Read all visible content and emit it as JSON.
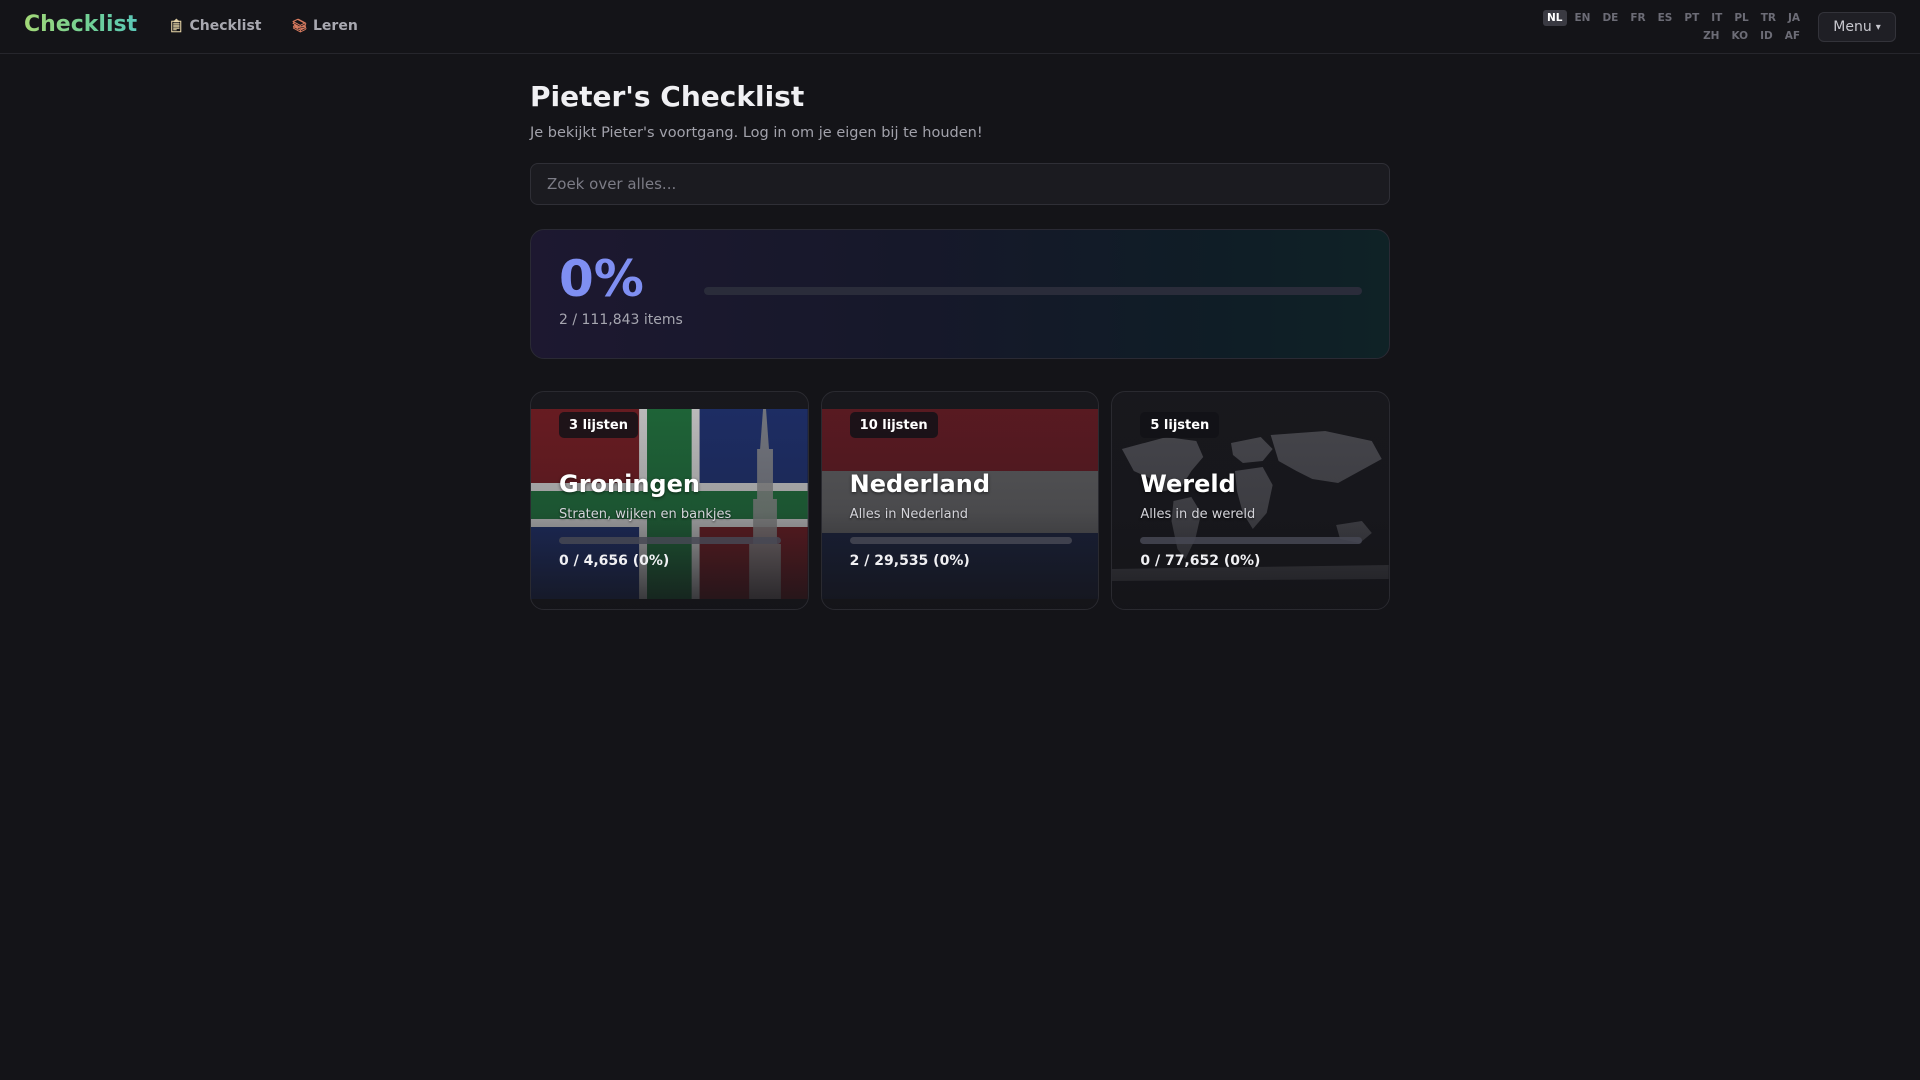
{
  "header": {
    "brand": "Checklist",
    "nav": [
      {
        "label": "Checklist",
        "icon": "clipboard-icon"
      },
      {
        "label": "Leren",
        "icon": "books-icon"
      }
    ],
    "languages": [
      "NL",
      "EN",
      "DE",
      "FR",
      "ES",
      "PT",
      "IT",
      "PL",
      "TR",
      "JA",
      "ZH",
      "KO",
      "ID",
      "AF"
    ],
    "active_language": "NL",
    "menu_label": "Menu",
    "menu_icon": "caret-down-icon"
  },
  "page": {
    "title": "Pieter's Checklist",
    "subtitle": "Je bekijkt Pieter's voortgang. Log in om je eigen bij te houden!",
    "search_placeholder": "Zoek over alles..."
  },
  "overall": {
    "percent_label": "0%",
    "count_label": "2 / 111,843 items",
    "completed": 2,
    "total": 111843,
    "accent_color": "#7f8ff2"
  },
  "categories": [
    {
      "badge": "3 lijsten",
      "title": "Groningen",
      "subtitle": "Straten, wijken en bankjes",
      "count_label": "0 / 4,656 (0%)",
      "done": 0,
      "total": 4656,
      "image": "groningen-flag-tower"
    },
    {
      "badge": "10 lijsten",
      "title": "Nederland",
      "subtitle": "Alles in Nederland",
      "count_label": "2 / 29,535 (0%)",
      "done": 2,
      "total": 29535,
      "image": "dutch-flag"
    },
    {
      "badge": "5 lijsten",
      "title": "Wereld",
      "subtitle": "Alles in de wereld",
      "count_label": "0 / 77,652 (0%)",
      "done": 0,
      "total": 77652,
      "image": "world-map"
    }
  ]
}
